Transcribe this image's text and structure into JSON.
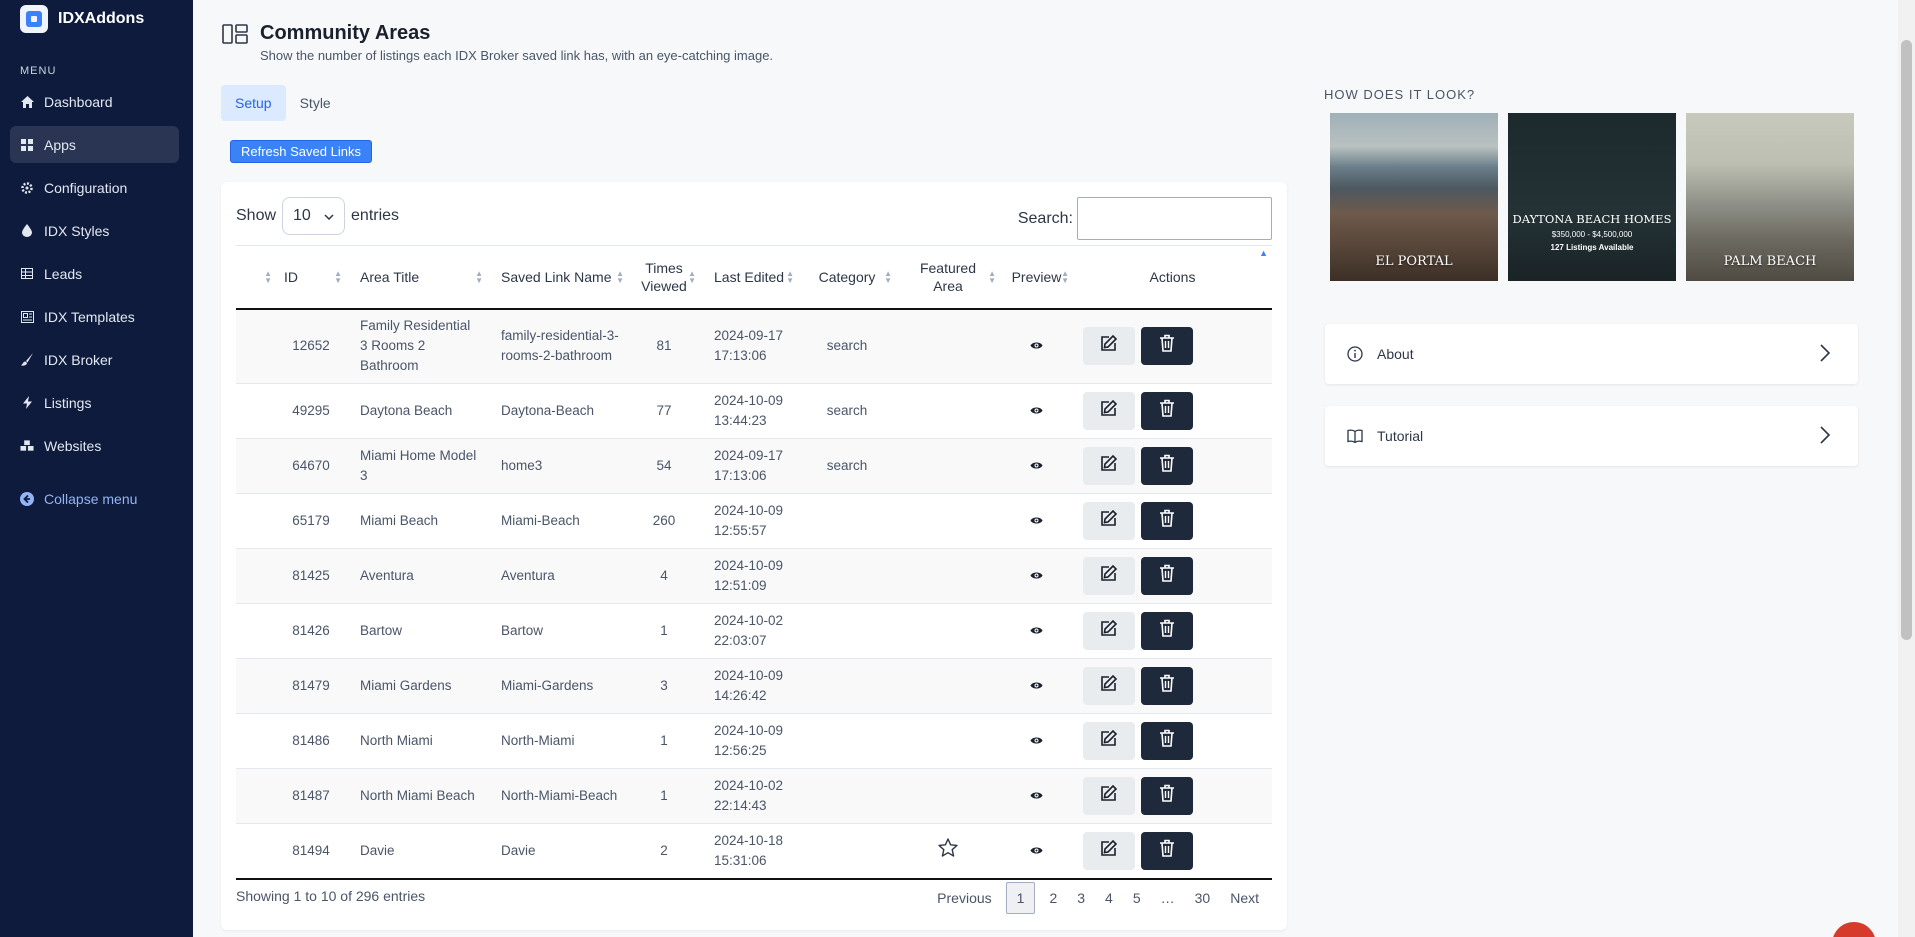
{
  "sidebar": {
    "brand": "IDXAddons",
    "menu_label": "MENU",
    "items": [
      {
        "label": "Dashboard",
        "icon": "home-icon"
      },
      {
        "label": "Apps",
        "icon": "grid-icon"
      },
      {
        "label": "Configuration",
        "icon": "gear-icon"
      },
      {
        "label": "IDX Styles",
        "icon": "droplet-icon"
      },
      {
        "label": "Leads",
        "icon": "table-icon"
      },
      {
        "label": "IDX Templates",
        "icon": "template-icon"
      },
      {
        "label": "IDX Broker",
        "icon": "brush-icon"
      },
      {
        "label": "Listings",
        "icon": "bolt-icon"
      },
      {
        "label": "Websites",
        "icon": "cubes-icon"
      }
    ],
    "collapse": "Collapse menu"
  },
  "header": {
    "title": "Community Areas",
    "subtitle": "Show the number of listings each IDX Broker saved link has, with an eye-catching image."
  },
  "tabs": [
    "Setup",
    "Style"
  ],
  "refresh_label": "Refresh Saved Links",
  "table_controls": {
    "show": "Show",
    "entries_value": "10",
    "entries": "entries",
    "search_label": "Search:"
  },
  "columns": [
    "ID",
    "Area Title",
    "Saved Link Name",
    "Times Viewed",
    "Last Edited",
    "Category",
    "Featured Area",
    "Preview",
    "Actions"
  ],
  "rows": [
    {
      "id": "12652",
      "title": "Family Residential 3 Rooms 2 Bathroom",
      "link": "family-residential-3-rooms-2-bathroom",
      "views": "81",
      "edited": "2024-09-17 17:13:06",
      "category": "search",
      "featured": false
    },
    {
      "id": "49295",
      "title": "Daytona Beach",
      "link": "Daytona-Beach",
      "views": "77",
      "edited": "2024-10-09 13:44:23",
      "category": "search",
      "featured": false
    },
    {
      "id": "64670",
      "title": "Miami Home Model 3",
      "link": "home3",
      "views": "54",
      "edited": "2024-09-17 17:13:06",
      "category": "search",
      "featured": false
    },
    {
      "id": "65179",
      "title": "Miami Beach",
      "link": "Miami-Beach",
      "views": "260",
      "edited": "2024-10-09 12:55:57",
      "category": "",
      "featured": false
    },
    {
      "id": "81425",
      "title": "Aventura",
      "link": "Aventura",
      "views": "4",
      "edited": "2024-10-09 12:51:09",
      "category": "",
      "featured": false
    },
    {
      "id": "81426",
      "title": "Bartow",
      "link": "Bartow",
      "views": "1",
      "edited": "2024-10-02 22:03:07",
      "category": "",
      "featured": false
    },
    {
      "id": "81479",
      "title": "Miami Gardens",
      "link": "Miami-Gardens",
      "views": "3",
      "edited": "2024-10-09 14:26:42",
      "category": "",
      "featured": false
    },
    {
      "id": "81486",
      "title": "North Miami",
      "link": "North-Miami",
      "views": "1",
      "edited": "2024-10-09 12:56:25",
      "category": "",
      "featured": false
    },
    {
      "id": "81487",
      "title": "North Miami Beach",
      "link": "North-Miami-Beach",
      "views": "1",
      "edited": "2024-10-02 22:14:43",
      "category": "",
      "featured": false
    },
    {
      "id": "81494",
      "title": "Davie",
      "link": "Davie",
      "views": "2",
      "edited": "2024-10-18 15:31:06",
      "category": "",
      "featured": true
    }
  ],
  "info": "Showing 1 to 10 of 296 entries",
  "pagination": [
    "Previous",
    "1",
    "2",
    "3",
    "4",
    "5",
    "…",
    "30",
    "Next"
  ],
  "current_page": "1",
  "preview": {
    "heading": "HOW DOES IT LOOK?",
    "cards": [
      {
        "label": "EL PORTAL"
      },
      {
        "label": "DAYTONA BEACH HOMES",
        "price": "$350,000 - $4,500,000",
        "count": "127 Listings Available"
      },
      {
        "label": "PALM BEACH"
      }
    ]
  },
  "accordions": [
    {
      "label": "About",
      "icon": "info-icon"
    },
    {
      "label": "Tutorial",
      "icon": "book-icon"
    }
  ],
  "colors": {
    "sidebar": "#0f1b3d",
    "accent": "#3b82f6",
    "delete": "#1e293b"
  }
}
